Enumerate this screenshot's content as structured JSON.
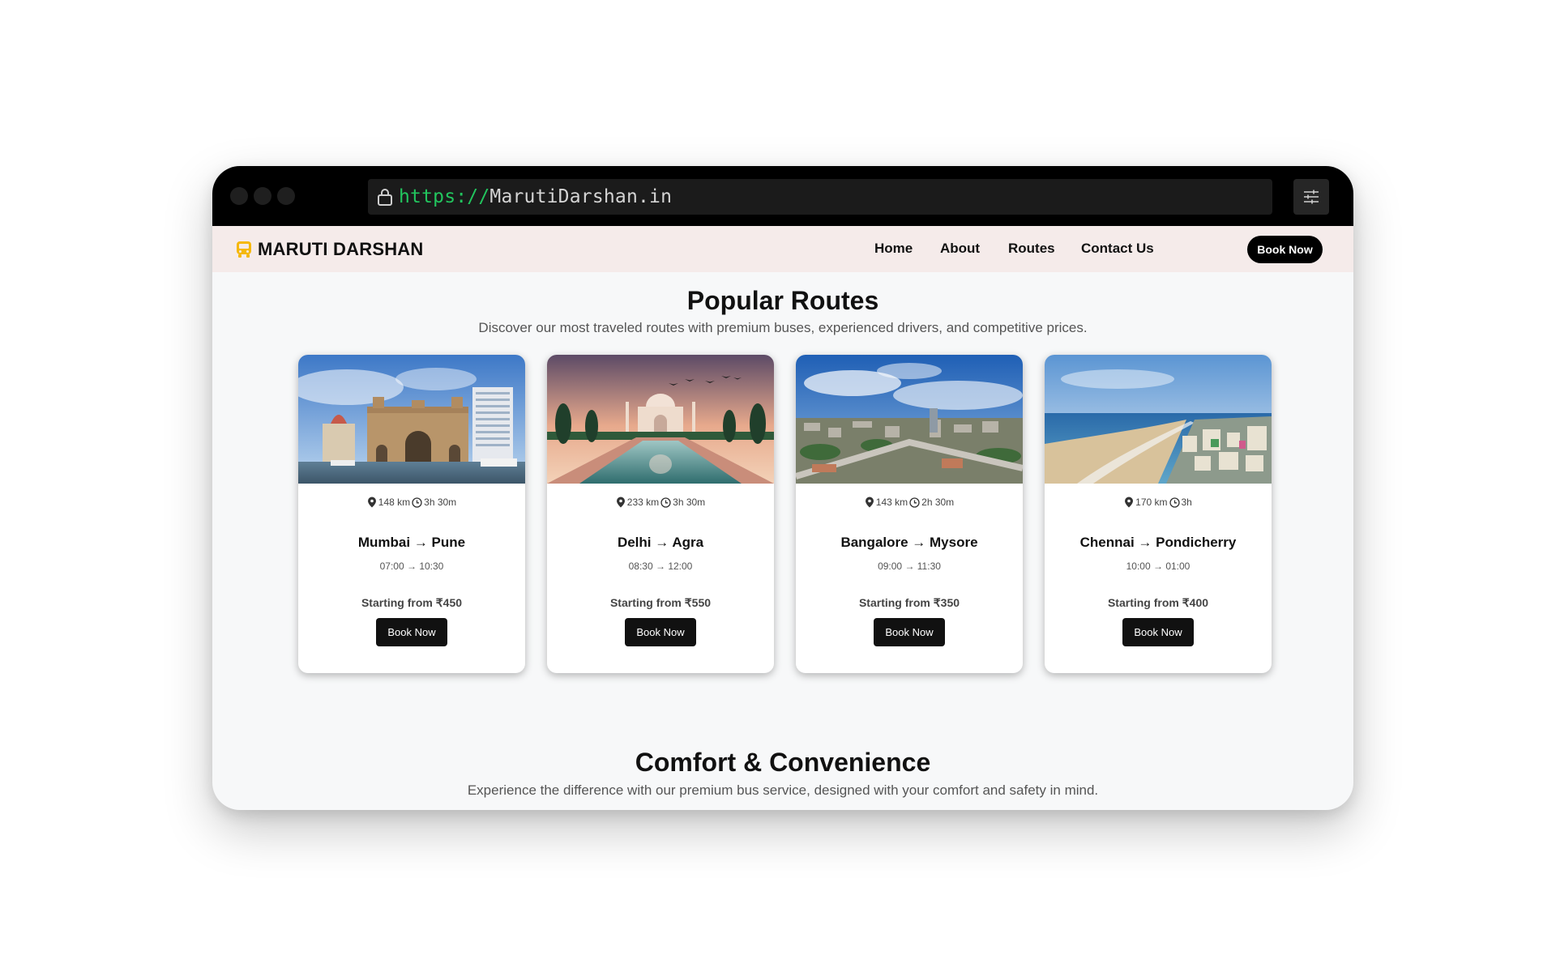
{
  "browser": {
    "url_scheme": "https://",
    "url_host": "MarutiDarshan.in"
  },
  "brand": {
    "name": "MARUTI DARSHAN",
    "icon": "bus-icon",
    "icon_color": "#f5b80b"
  },
  "nav": {
    "links": [
      "Home",
      "About",
      "Routes",
      "Contact Us"
    ],
    "book_label": "Book Now"
  },
  "popular": {
    "title": "Popular Routes",
    "subtitle": "Discover our most traveled routes with premium buses, experienced drivers, and competitive prices.",
    "routes": [
      {
        "distance": "148 km",
        "duration": "3h 30m",
        "name": "Mumbai → Pune",
        "times": "07:00 → 10:30",
        "price": "Starting from ₹450",
        "button": "Book Now",
        "image": "gateway-of-india-photo"
      },
      {
        "distance": "233 km",
        "duration": "3h 30m",
        "name": "Delhi → Agra",
        "times": "08:30 → 12:00",
        "price": "Starting from ₹550",
        "button": "Book Now",
        "image": "taj-mahal-photo"
      },
      {
        "distance": "143 km",
        "duration": "2h 30m",
        "name": "Bangalore → Mysore",
        "times": "09:00 → 11:30",
        "price": "Starting from ₹350",
        "button": "Book Now",
        "image": "bangalore-city-photo"
      },
      {
        "distance": "170 km",
        "duration": "3h",
        "name": "Chennai → Pondicherry",
        "times": "10:00 → 01:00",
        "price": "Starting from ₹400",
        "button": "Book Now",
        "image": "chennai-beach-photo"
      }
    ]
  },
  "comfort": {
    "title": "Comfort & Convenience",
    "subtitle": "Experience the difference with our premium bus service, designed with your comfort and safety in mind."
  }
}
